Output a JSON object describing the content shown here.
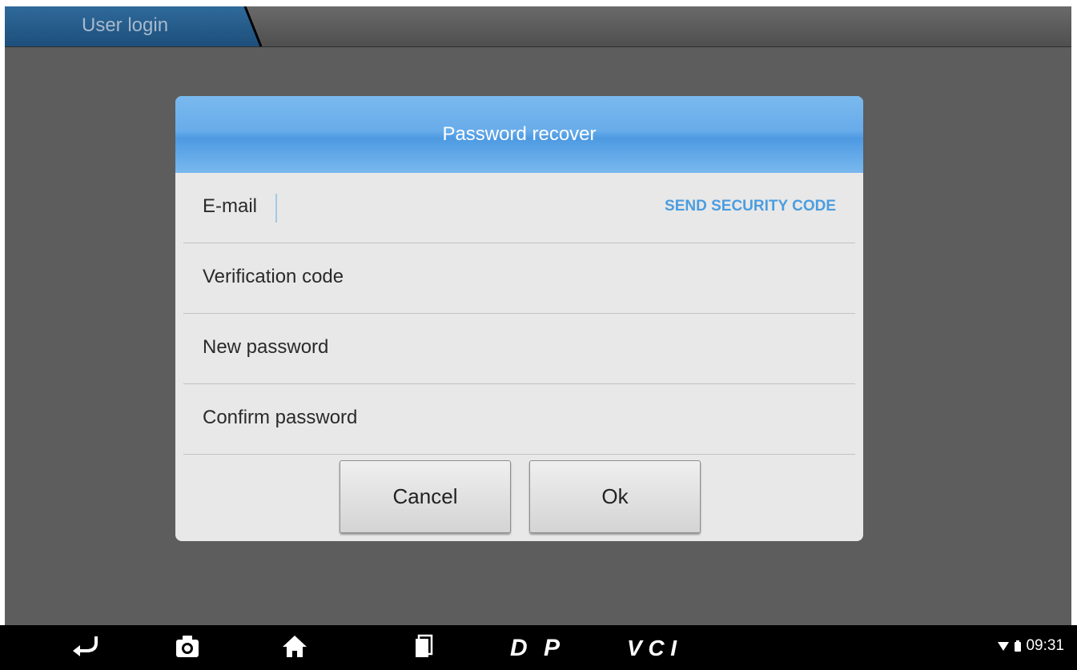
{
  "tab": {
    "label": "User login"
  },
  "dialog": {
    "title": "Password recover",
    "fields": [
      {
        "label": "E-mail"
      },
      {
        "label": "Verification code"
      },
      {
        "label": "New password"
      },
      {
        "label": "Confirm password"
      }
    ],
    "send_code_label": "SEND SECURITY CODE",
    "cancel_label": "Cancel",
    "ok_label": "Ok"
  },
  "navbar": {
    "icons": [
      "back-icon",
      "camera-icon",
      "home-icon",
      "recent-apps-icon",
      "dp-icon",
      "vci-icon"
    ],
    "dp_label": "DP",
    "vci_label": "VCI"
  },
  "status": {
    "time": "09:31"
  },
  "colors": {
    "header_blue": "#5aa5e8",
    "link_blue": "#4b9de0",
    "screen_bg": "#5d5d5d"
  }
}
